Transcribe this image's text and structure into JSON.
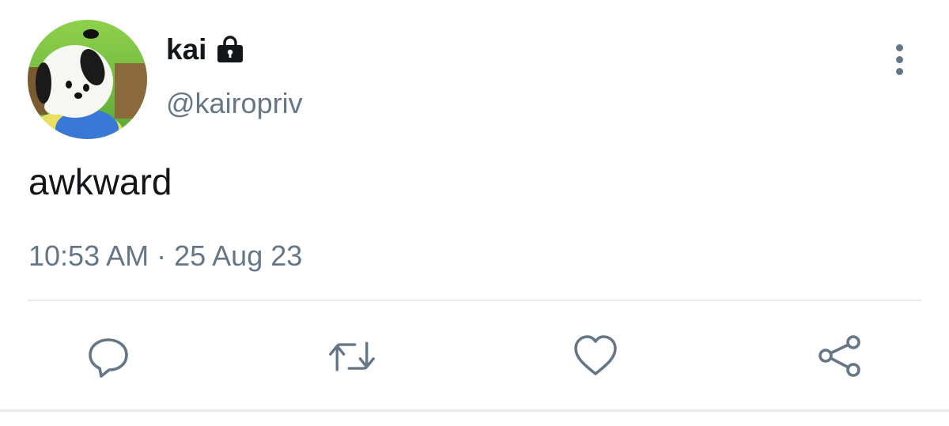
{
  "user": {
    "display_name": "kai",
    "handle": "@kairopriv",
    "protected_icon": "lock-icon",
    "avatar": "avatar"
  },
  "tweet": {
    "text": "awkward",
    "timestamp": "10:53 AM · 25 Aug 23"
  },
  "menu": {
    "icon": "more-vertical-icon"
  },
  "actions": [
    {
      "name": "reply",
      "icon": "reply-icon"
    },
    {
      "name": "retweet",
      "icon": "retweet-icon"
    },
    {
      "name": "like",
      "icon": "heart-icon"
    },
    {
      "name": "share",
      "icon": "share-icon"
    }
  ],
  "colors": {
    "text_primary": "#14171a",
    "text_secondary": "#657786",
    "divider": "#e6ecf0",
    "background": "#ffffff"
  }
}
